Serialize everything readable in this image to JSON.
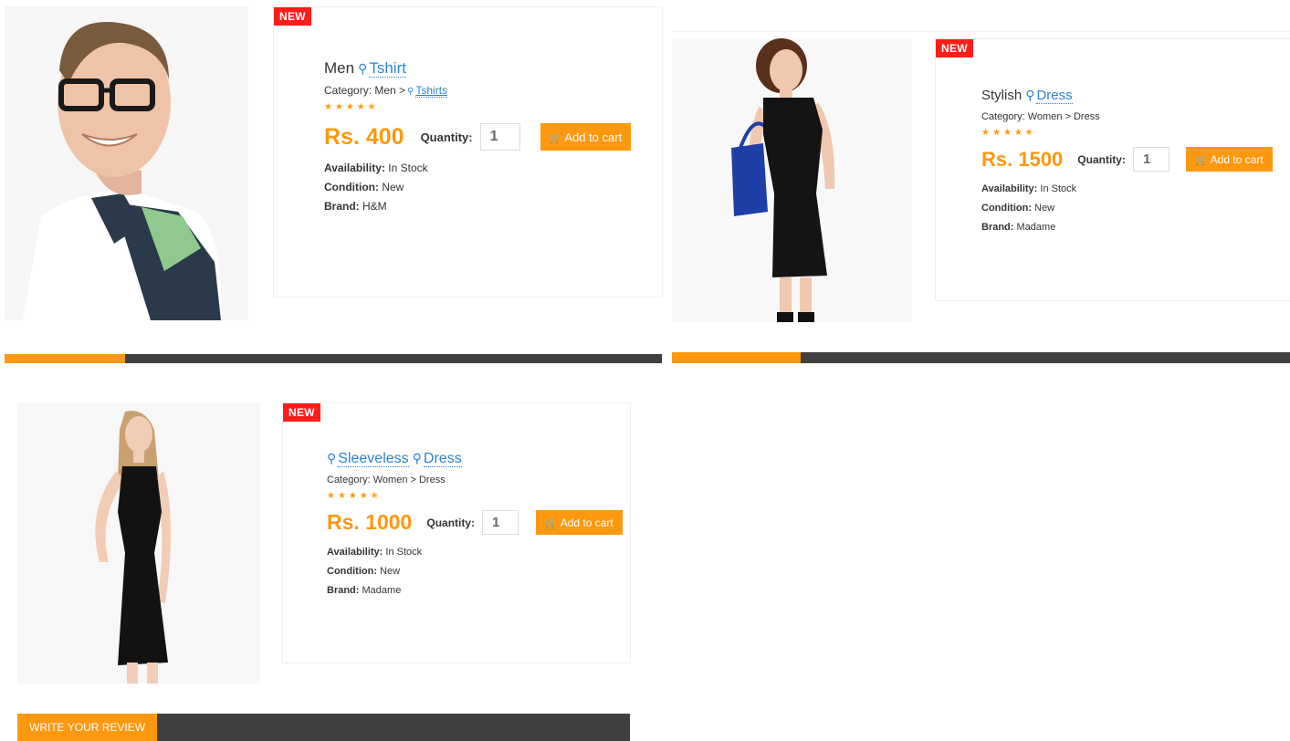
{
  "colors": {
    "accent": "#fe980f",
    "badge": "#fe1e19",
    "link": "#2d82d4",
    "tab_bar": "#40403e"
  },
  "products": [
    {
      "badge": "NEW",
      "title_prefix": "Men",
      "title_link": "Tshirt",
      "category_text": "Category: Men >",
      "category_link": "Tshirts",
      "rating_stars": "★★★★✬",
      "price": "Rs. 400",
      "quantity_label": "Quantity:",
      "quantity_value": "1",
      "cart_label": "Add to cart",
      "availability_label": "Availability:",
      "availability_value": "In Stock",
      "condition_label": "Condition:",
      "condition_value": "New",
      "brand_label": "Brand:",
      "brand_value": "H&M"
    },
    {
      "badge": "NEW",
      "title_prefix": "Stylish",
      "title_link": "Dress",
      "category_text": "Category: Women > Dress",
      "rating_stars": "★★★★✬",
      "price": "Rs. 1500",
      "quantity_label": "Quantity:",
      "quantity_value": "1",
      "cart_label": "Add to cart",
      "availability_label": "Availability:",
      "availability_value": "In Stock",
      "condition_label": "Condition:",
      "condition_value": "New",
      "brand_label": "Brand:",
      "brand_value": "Madame"
    },
    {
      "badge": "NEW",
      "title_link_1": "Sleeveless",
      "title_link_2": "Dress",
      "category_text": "Category: Women > Dress",
      "rating_stars": "★★★★✬",
      "price": "Rs. 1000",
      "quantity_label": "Quantity:",
      "quantity_value": "1",
      "cart_label": "Add to cart",
      "availability_label": "Availability:",
      "availability_value": "In Stock",
      "condition_label": "Condition:",
      "condition_value": "New",
      "brand_label": "Brand:",
      "brand_value": "Madame"
    }
  ],
  "review": {
    "tab_label": "WRITE YOUR REVIEW"
  }
}
